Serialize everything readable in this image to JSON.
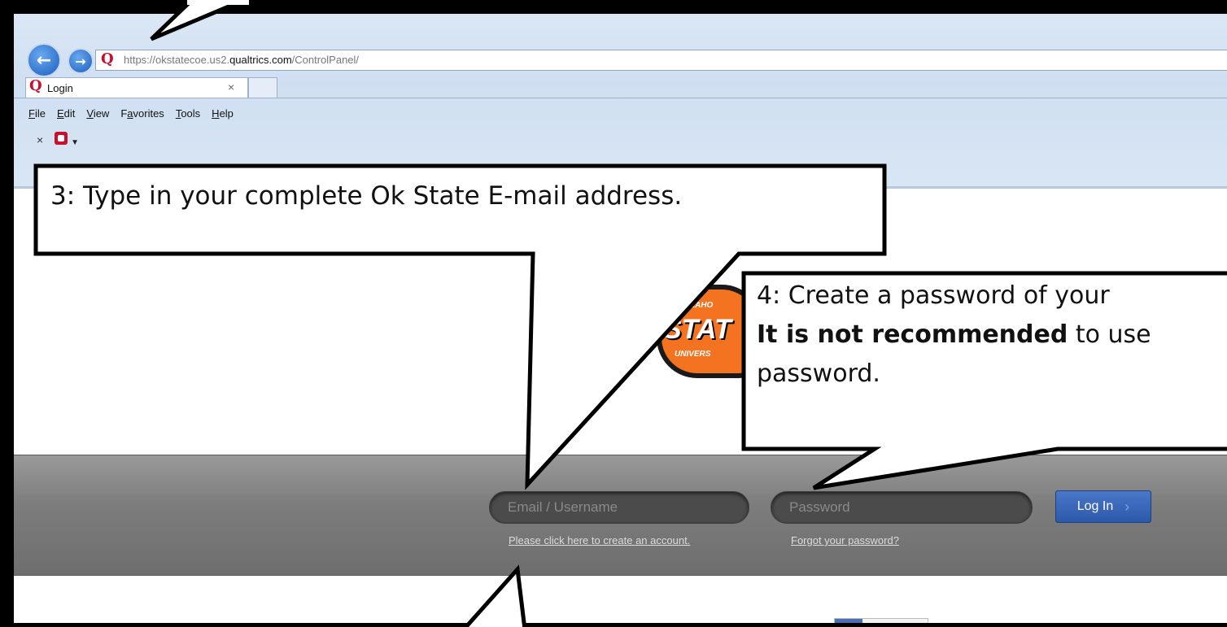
{
  "browser": {
    "url_prefix": "https://okstatecoe.us2.",
    "url_host": "qualtrics.com",
    "url_path": "/ControlPanel/",
    "tab_title": "Login",
    "tab_close": "×",
    "menu": [
      {
        "first": "F",
        "rest": "ile"
      },
      {
        "first": "E",
        "rest": "dit"
      },
      {
        "first": "V",
        "rest": "iew"
      },
      {
        "first": "F",
        "rest": "avorites"
      },
      {
        "first": "T",
        "rest": "ools"
      },
      {
        "first": "H",
        "rest": "elp"
      }
    ],
    "command_close": "×"
  },
  "logo": {
    "line1": "OKLAHO",
    "line2": "STAT",
    "line3": "UNIVERS"
  },
  "login": {
    "email_placeholder": "Email / Username",
    "password_placeholder": "Password",
    "login_label": "Log In",
    "create_account_link": "Please click here to create an account.",
    "forgot_password_link": "Forgot your password?"
  },
  "callouts": {
    "step3": "3:  Type in your complete Ok State E-mail address.",
    "step4_line1": "4:  Create a password of your",
    "step4_line2_bold": "It is not recommended",
    "step4_line2_rest": " to use",
    "step4_line3": "password."
  }
}
